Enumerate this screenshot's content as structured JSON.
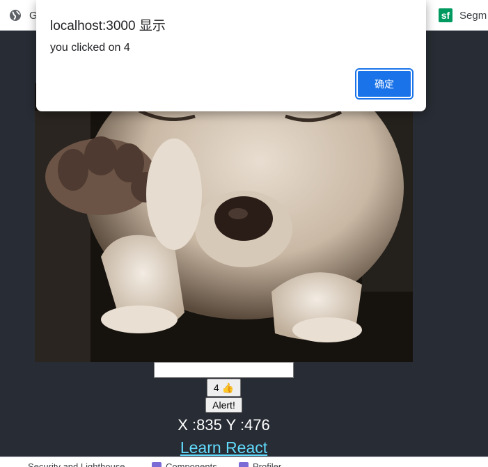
{
  "bookmarks": {
    "left_item": {
      "label": "G",
      "icon": "globe-icon"
    },
    "right_item": {
      "label": "Segm",
      "icon": "segmentfault-icon",
      "icon_text": "sf"
    }
  },
  "dialog": {
    "title": "localhost:3000 显示",
    "message": "you clicked on 4",
    "ok_label": "确定"
  },
  "app": {
    "photo_subject": "dog-photo",
    "input_value": "",
    "like_count": "4",
    "like_icon": "👍",
    "alert_label": "Alert!",
    "coords_text": "X :835 Y :476",
    "link_text": "Learn React"
  },
  "status_bar": {
    "items": [
      {
        "label": "Security and Lighthouse"
      },
      {
        "label": "Components",
        "icon": "extension-icon"
      },
      {
        "label": "Profiler",
        "icon": "extension-icon"
      }
    ]
  },
  "colors": {
    "app_background": "#282c34",
    "link": "#61dafb",
    "dialog_button": "#1a73e8",
    "sf_brand": "#009a61"
  }
}
